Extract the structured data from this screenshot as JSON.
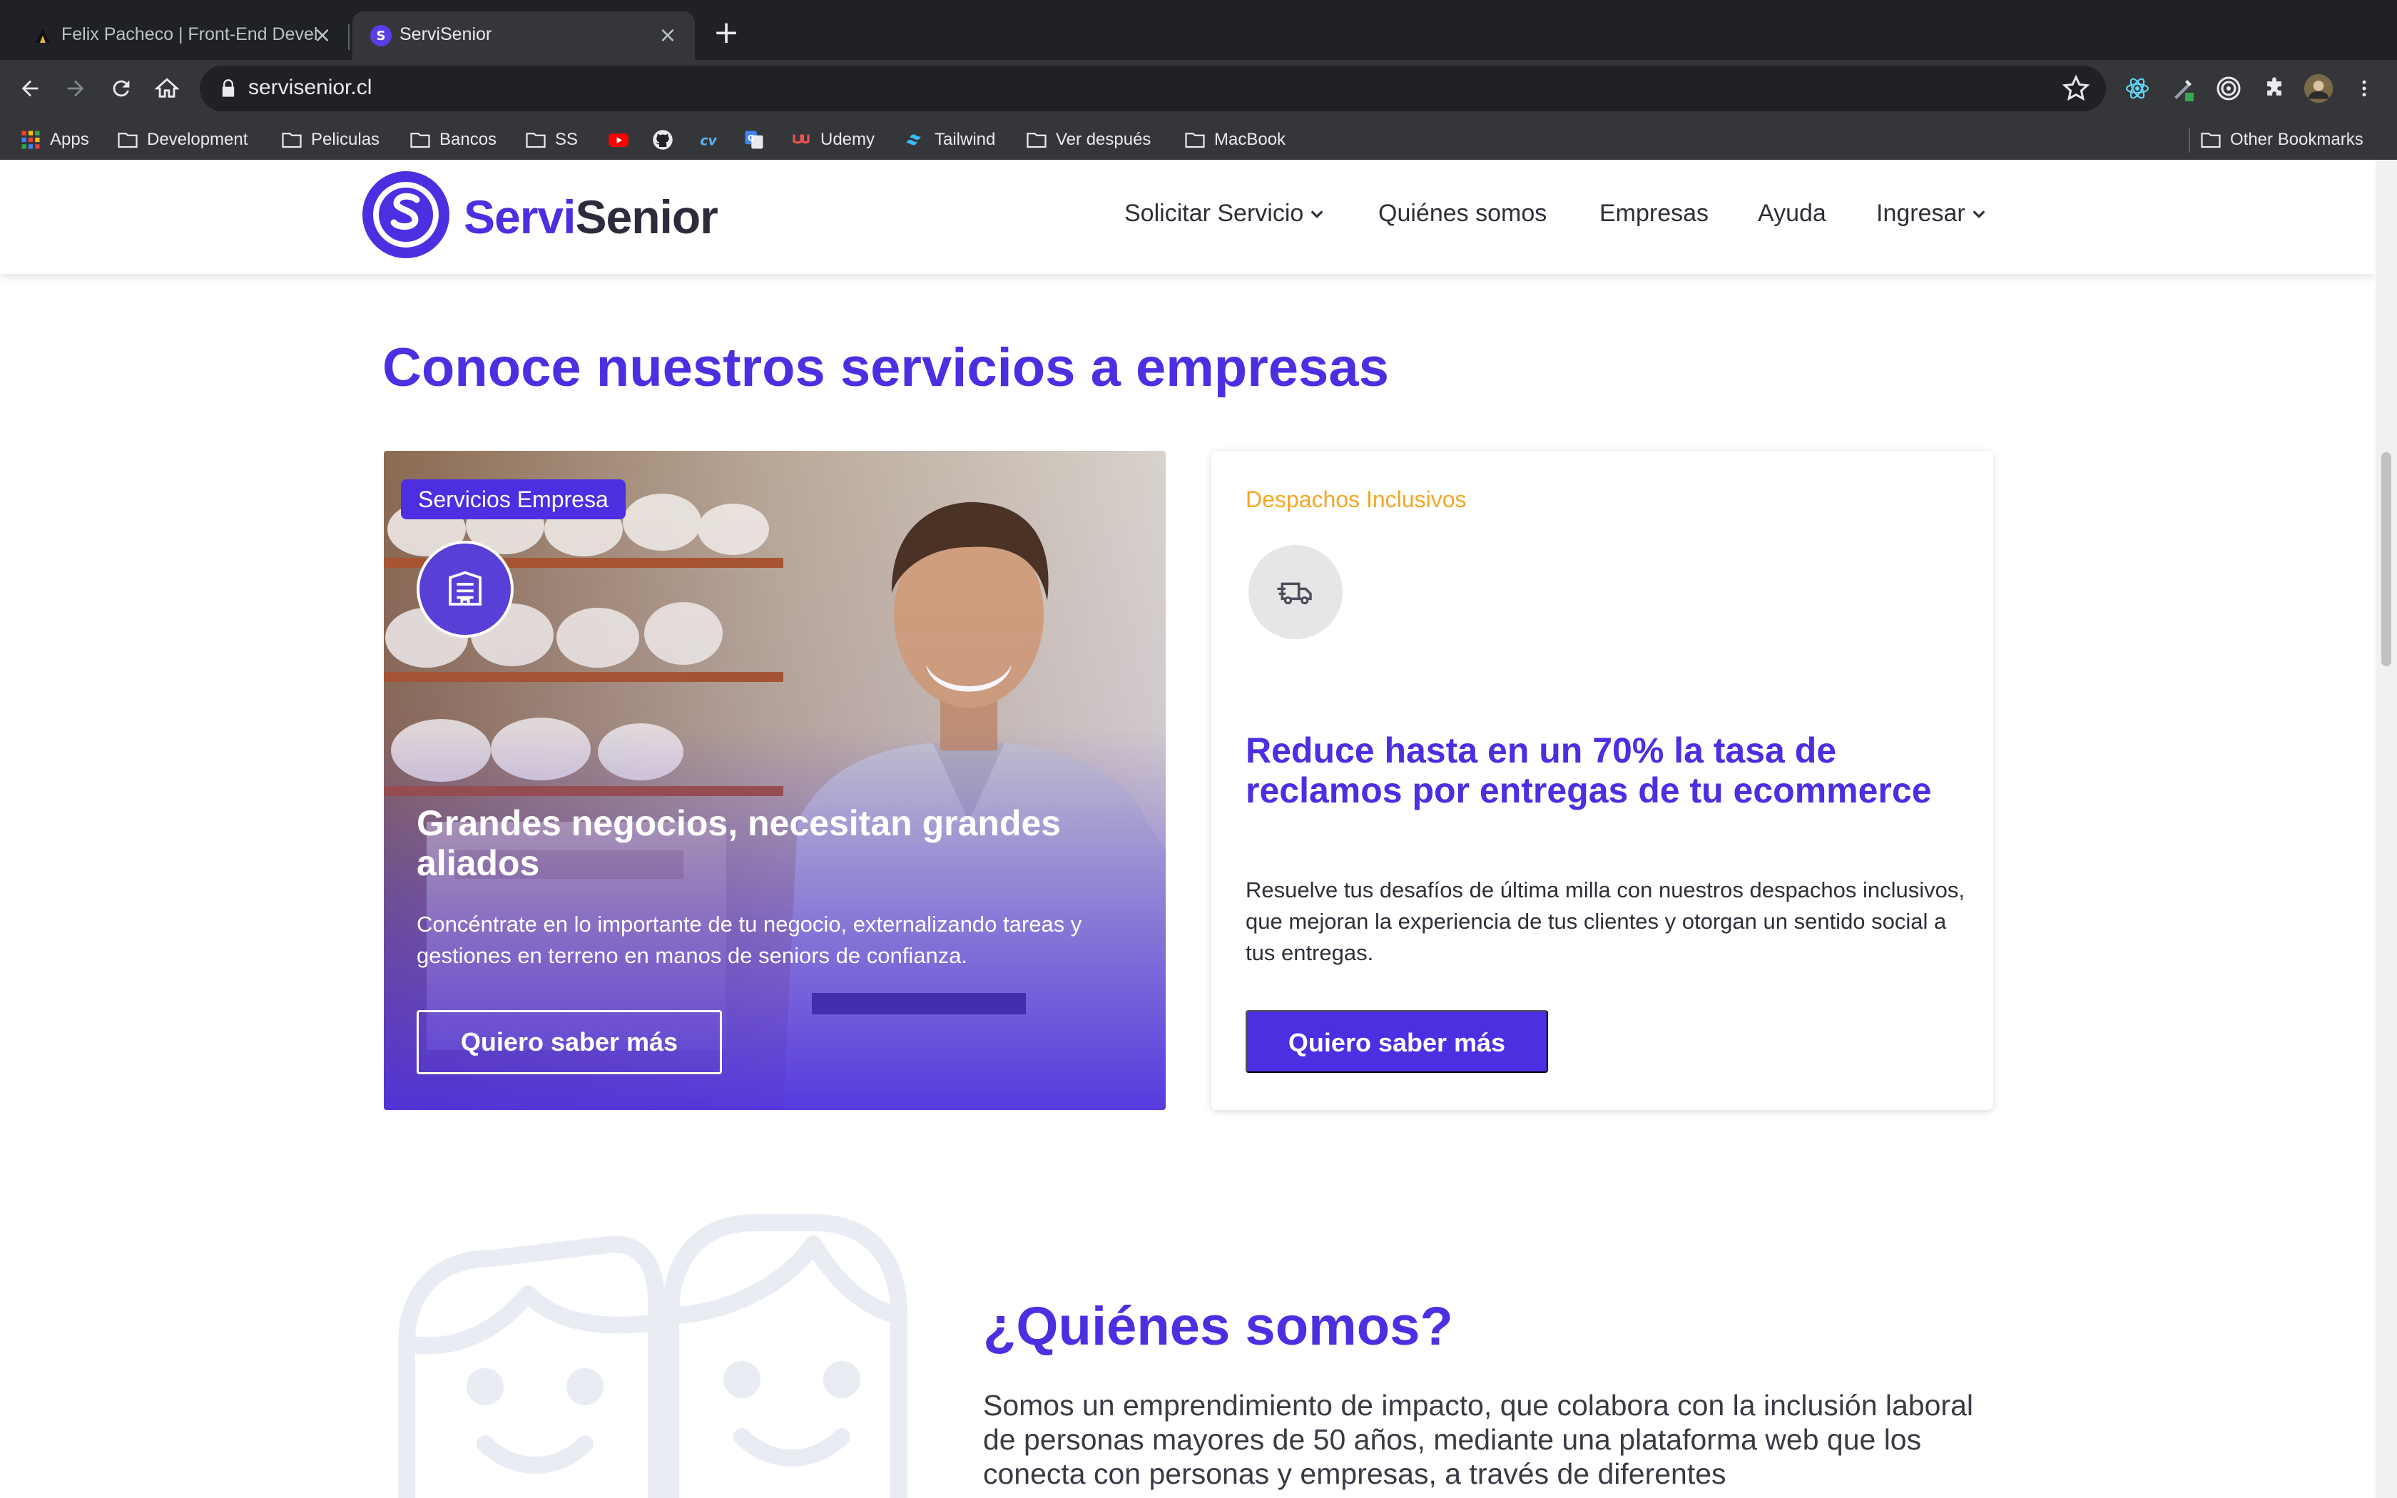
{
  "browser": {
    "tabs": [
      {
        "title": "Felix Pacheco | Front-End Developer",
        "active": false
      },
      {
        "title": "ServiSenior",
        "active": true
      }
    ],
    "url": "servisenior.cl",
    "bookmarks": [
      {
        "label": "Apps",
        "icon": "apps-grid-icon"
      },
      {
        "label": "Development",
        "icon": "folder-icon"
      },
      {
        "label": "Peliculas",
        "icon": "folder-icon"
      },
      {
        "label": "Bancos",
        "icon": "folder-icon"
      },
      {
        "label": "SS",
        "icon": "folder-icon"
      },
      {
        "label": "",
        "icon": "youtube-icon"
      },
      {
        "label": "",
        "icon": "github-icon"
      },
      {
        "label": "",
        "icon": "cv-icon"
      },
      {
        "label": "",
        "icon": "translate-icon"
      },
      {
        "label": "Udemy",
        "icon": "udemy-icon"
      },
      {
        "label": "Tailwind",
        "icon": "tailwind-icon"
      },
      {
        "label": "Ver después",
        "icon": "folder-icon"
      },
      {
        "label": "MacBook",
        "icon": "folder-icon"
      }
    ],
    "other_bookmarks": "Other Bookmarks"
  },
  "site": {
    "logo": {
      "part1": "Servi",
      "part2": "Senior"
    },
    "nav": [
      {
        "label": "Solicitar Servicio",
        "dropdown": true
      },
      {
        "label": "Quiénes somos",
        "dropdown": false
      },
      {
        "label": "Empresas",
        "dropdown": false
      },
      {
        "label": "Ayuda",
        "dropdown": false
      },
      {
        "label": "Ingresar",
        "dropdown": true
      }
    ],
    "brand_color": "#4d2ee0",
    "accent_color": "#f5a623"
  },
  "main": {
    "section_title": "Conoce nuestros servicios a empresas",
    "card_business": {
      "chip": "Servicios Empresa",
      "icon": "building-icon",
      "headline": "Grandes negocios, necesitan grandes aliados",
      "body": "Concéntrate en lo importante de tu negocio, externalizando tareas y gestiones en terreno en manos de seniors de confianza.",
      "button": "Quiero saber más"
    },
    "card_delivery": {
      "eyebrow": "Despachos Inclusivos",
      "icon": "delivery-truck-icon",
      "headline": "Reduce hasta en un 70% la tasa de reclamos por entregas de tu ecommerce",
      "body": "Resuelve tus desafíos de última milla con nuestros despachos inclusivos, que mejoran la experiencia de tus clientes y otorgan un sentido social a tus entregas.",
      "button": "Quiero saber más"
    },
    "about": {
      "title": "¿Quiénes somos?",
      "body": "Somos un emprendimiento de impacto, que colabora con la inclusión laboral de personas mayores de 50 años, mediante una plataforma web que los conecta con personas y empresas, a través de diferentes"
    }
  }
}
